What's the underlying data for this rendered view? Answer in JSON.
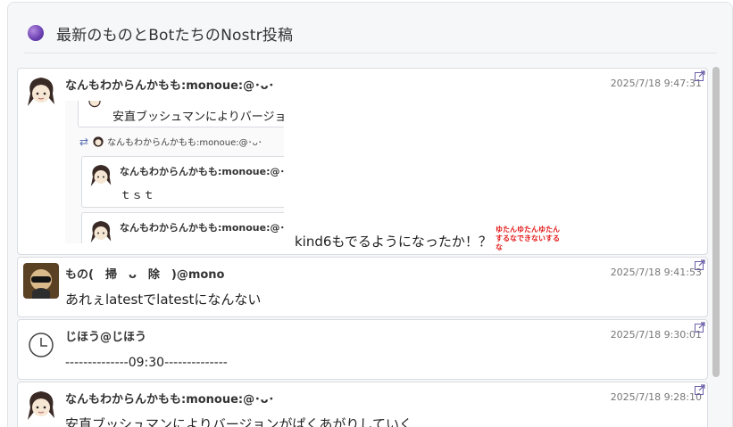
{
  "panel": {
    "title": "最新のものとBotたちのNostr投稿"
  },
  "posts": [
    {
      "author": "なんもわからんかもも:monoue:@･ᴗ･",
      "time": "2025/7/18 9:47:31",
      "text": "kind6もでるようになったか！？",
      "sticker": "ゆたんゆたんゆたん するなできないするな",
      "embed": {
        "top_text": "安直ブッシュマンによりバージョ",
        "repost_author": "なんもわからんかもも:monoue:@･ᴗ･",
        "inner_author_1": "なんもわからんかもも:monoue:@･ᴗ･",
        "inner_text_1": "ｔｓｔ",
        "inner_author_2": "なんもわからんかもも:monoue:@･ᴗ･"
      }
    },
    {
      "author": "もの(　掃　ᴗ　除　)@mono",
      "time": "2025/7/18 9:41:53",
      "text": "あれぇlatestでlatestになんない"
    },
    {
      "author": "じほう@じほう",
      "time": "2025/7/18 9:30:01",
      "text": "--------------09:30--------------"
    },
    {
      "author": "なんもわからんかもも:monoue:@･ᴗ･",
      "time": "2025/7/18 9:28:10",
      "text": "安直ブッシュマンによりバージョンがぱくあがりしていく"
    }
  ],
  "colors": {
    "accent": "#6a3fb1",
    "card_border": "#d9dce1",
    "sticker": "#e31b1b"
  },
  "icons": {
    "header": "purple-dot-icon",
    "external": "external-link-icon",
    "repost": "repost-icon",
    "clock": "clock-icon"
  }
}
